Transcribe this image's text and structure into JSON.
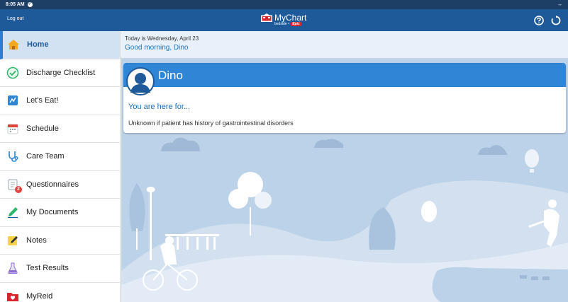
{
  "status_bar": {
    "time": "8:05 AM"
  },
  "app_bar": {
    "logout_label": "Log out",
    "brand_title": "MyChart",
    "brand_sub_left": "bedside",
    "brand_sub_right": "Epic",
    "help_icon": "help-circle-icon",
    "settings_icon": "refresh-icon"
  },
  "sidebar": {
    "items": [
      {
        "label": "Home",
        "icon": "home-icon",
        "active": true
      },
      {
        "label": "Discharge Checklist",
        "icon": "checkmark-circle-icon"
      },
      {
        "label": "Let's Eat!",
        "icon": "meal-icon"
      },
      {
        "label": "Schedule",
        "icon": "calendar-icon"
      },
      {
        "label": "Care Team",
        "icon": "stethoscope-icon"
      },
      {
        "label": "Questionnaires",
        "icon": "clipboard-icon",
        "badge": "2"
      },
      {
        "label": "My Documents",
        "icon": "pen-icon"
      },
      {
        "label": "Notes",
        "icon": "note-pencil-icon"
      },
      {
        "label": "Test Results",
        "icon": "flask-icon"
      },
      {
        "label": "MyReid",
        "icon": "folder-heart-icon"
      }
    ]
  },
  "greeting": {
    "date_text": "Today is Wednesday, April 23",
    "message": "Good morning, Dino"
  },
  "patient_card": {
    "name": "Dino",
    "here_for_title": "You are here for...",
    "reason": "Unknown if patient has history of gastrointestinal disorders"
  },
  "colors": {
    "app_bar": "#1e5a9a",
    "accent": "#2f86d6",
    "scene_bg": "#bcd2e8"
  }
}
